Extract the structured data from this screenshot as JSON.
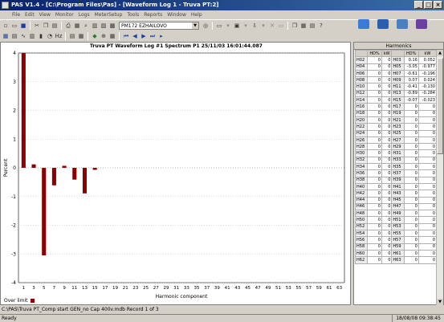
{
  "window": {
    "title": "PAS V1.4 - [C:\\Program Files\\Pas] - [Waveform Log 1 - Truva PT:2]"
  },
  "menu": [
    "File",
    "Edit",
    "View",
    "Monitor",
    "Logs",
    "MeterSetup",
    "Tools",
    "Reports",
    "Window",
    "Help"
  ],
  "toolbar": {
    "device_select": "PM172 EZHAILOVO"
  },
  "big_buttons": [
    "",
    "",
    "",
    ""
  ],
  "chart": {
    "title": "Truva PT  Waveform Log #1  Spectrum P1  25/11/03  16:01:44.087",
    "legend_label": "Over limit"
  },
  "chart_data": {
    "type": "bar",
    "xlabel": "Harmonic component",
    "ylabel": "Percent",
    "ylim": [
      -4,
      4
    ],
    "x_ticks": [
      1,
      3,
      5,
      7,
      9,
      11,
      13,
      15,
      17,
      19,
      21,
      23,
      25,
      27,
      29,
      31,
      33,
      35,
      37,
      39,
      41,
      43,
      45,
      47,
      49,
      51,
      53,
      55,
      57,
      59,
      61,
      63
    ],
    "y_ticks": [
      -4,
      -3,
      -2,
      -1,
      0,
      1,
      2,
      3,
      4
    ],
    "categories": [
      1,
      2,
      3,
      4,
      5,
      6,
      7,
      8,
      9,
      10,
      11,
      12,
      13,
      14,
      15,
      16
    ],
    "values": [
      4.0,
      0.0,
      0.12,
      0.0,
      -3.05,
      0.0,
      -0.61,
      0.0,
      0.07,
      0.0,
      -0.41,
      0.0,
      -0.89,
      0.0,
      -0.07,
      0.0
    ],
    "color": "#8b0000",
    "grid": "horizontal dotted"
  },
  "harmonics": {
    "title": "Harmonics",
    "headers": [
      "",
      "HD%",
      "kW",
      "",
      "HD%",
      "kW"
    ],
    "rows": [
      [
        "H02",
        "0",
        "0",
        "H03",
        "0.16",
        "0.052"
      ],
      [
        "H04",
        "0",
        "0",
        "H05",
        "-3.05",
        "-0.977"
      ],
      [
        "H06",
        "0",
        "0",
        "H07",
        "-0.61",
        "-0.196"
      ],
      [
        "H08",
        "0",
        "0",
        "H09",
        "0.07",
        "0.024"
      ],
      [
        "H10",
        "0",
        "0",
        "H11",
        "-0.41",
        "-0.130"
      ],
      [
        "H12",
        "0",
        "0",
        "H13",
        "-0.89",
        "-0.284"
      ],
      [
        "H14",
        "0",
        "0",
        "H15",
        "-0.07",
        "-0.023"
      ],
      [
        "H16",
        "0",
        "0",
        "H17",
        "0",
        "0"
      ],
      [
        "H18",
        "0",
        "0",
        "H19",
        "0",
        "0"
      ],
      [
        "H20",
        "0",
        "0",
        "H21",
        "0",
        "0"
      ],
      [
        "H22",
        "0",
        "0",
        "H23",
        "0",
        "0"
      ],
      [
        "H24",
        "0",
        "0",
        "H25",
        "0",
        "0"
      ],
      [
        "H26",
        "0",
        "0",
        "H27",
        "0",
        "0"
      ],
      [
        "H28",
        "0",
        "0",
        "H29",
        "0",
        "0"
      ],
      [
        "H30",
        "0",
        "0",
        "H31",
        "0",
        "0"
      ],
      [
        "H32",
        "0",
        "0",
        "H33",
        "0",
        "0"
      ],
      [
        "H34",
        "0",
        "0",
        "H35",
        "0",
        "0"
      ],
      [
        "H36",
        "0",
        "0",
        "H37",
        "0",
        "0"
      ],
      [
        "H38",
        "0",
        "0",
        "H39",
        "0",
        "0"
      ],
      [
        "H40",
        "0",
        "0",
        "H41",
        "0",
        "0"
      ],
      [
        "H42",
        "0",
        "0",
        "H43",
        "0",
        "0"
      ],
      [
        "H44",
        "0",
        "0",
        "H45",
        "0",
        "0"
      ],
      [
        "H46",
        "0",
        "0",
        "H47",
        "0",
        "0"
      ],
      [
        "H48",
        "0",
        "0",
        "H49",
        "0",
        "0"
      ],
      [
        "H50",
        "0",
        "0",
        "H51",
        "0",
        "0"
      ],
      [
        "H52",
        "0",
        "0",
        "H53",
        "0",
        "0"
      ],
      [
        "H54",
        "0",
        "0",
        "H55",
        "0",
        "0"
      ],
      [
        "H56",
        "0",
        "0",
        "H57",
        "0",
        "0"
      ],
      [
        "H58",
        "0",
        "0",
        "H59",
        "0",
        "0"
      ],
      [
        "H60",
        "0",
        "0",
        "H61",
        "0",
        "0"
      ],
      [
        "H62",
        "0",
        "0",
        "H63",
        "0",
        "0"
      ]
    ]
  },
  "status": {
    "path": "C:\\PAS\\Truva PT_Comp start GEN_no Cap 400v.mdb  Record 1 of 3",
    "ready": "Ready",
    "datetime": "18/08/08 09:38:45"
  }
}
